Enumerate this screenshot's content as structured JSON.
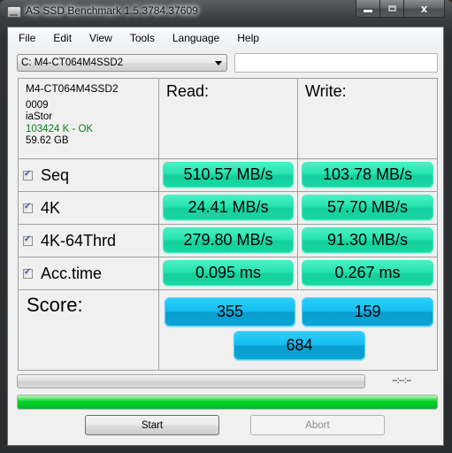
{
  "window": {
    "title": "AS SSD Benchmark 1.5.3784.37609",
    "controls": {
      "minimize": "minimize",
      "maximize": "maximize",
      "close": "x"
    }
  },
  "menu": [
    {
      "label": "File"
    },
    {
      "label": "Edit"
    },
    {
      "label": "View"
    },
    {
      "label": "Tools"
    },
    {
      "label": "Language"
    },
    {
      "label": "Help"
    }
  ],
  "drive_select": {
    "value": "C: M4-CT064M4SSD2"
  },
  "info_field": {
    "value": ""
  },
  "drive_info": {
    "model": "M4-CT064M4SSD2",
    "firmware": "0009",
    "driver": "iaStor",
    "alignment": "103424 K - OK",
    "capacity": "59.62 GB"
  },
  "headers": {
    "read": "Read:",
    "write": "Write:"
  },
  "tests": [
    {
      "label": "Seq",
      "checked": true,
      "read": "510.57 MB/s",
      "write": "103.78 MB/s"
    },
    {
      "label": "4K",
      "checked": true,
      "read": "24.41 MB/s",
      "write": "57.70 MB/s"
    },
    {
      "label": "4K-64Thrd",
      "checked": true,
      "read": "279.80 MB/s",
      "write": "91.30 MB/s"
    },
    {
      "label": "Acc.time",
      "checked": true,
      "read": "0.095 ms",
      "write": "0.267 ms"
    }
  ],
  "score": {
    "label": "Score:",
    "read": "355",
    "write": "159",
    "total": "684"
  },
  "progress": {
    "current_percent": 0,
    "total_percent": 100,
    "time": "--:--:--"
  },
  "buttons": {
    "start": "Start",
    "abort": "Abort"
  },
  "colors": {
    "result_green": "#25e4b0",
    "score_blue": "#13bdf0",
    "progress_green": "#00c423",
    "alignment_ok": "#0d7d1b"
  }
}
